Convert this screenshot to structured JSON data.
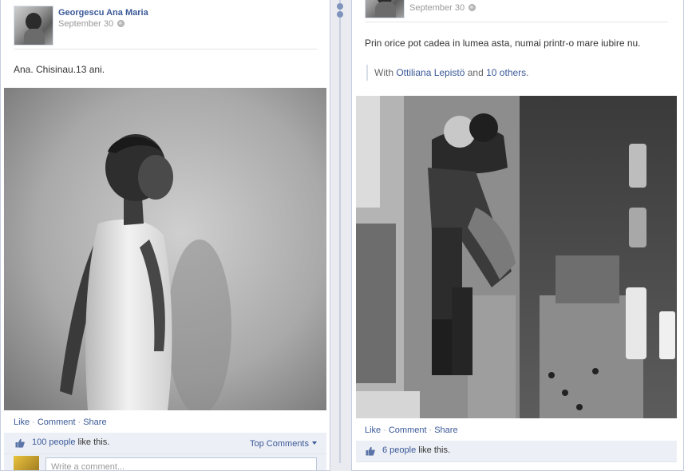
{
  "left_post": {
    "author": "Georgescu Ana Maria",
    "date": "September 30",
    "message": "Ana. Chisinau.13 ani.",
    "actions": {
      "like": "Like",
      "comment": "Comment",
      "share": "Share",
      "sep": "·"
    },
    "likes": {
      "count_link": "100 people",
      "suffix": "like this."
    },
    "top_comments": "Top Comments",
    "comment_placeholder": "Write a comment..."
  },
  "right_post": {
    "date": "September 30",
    "message": "Prin orice pot cadea in lumea asta, numai printr-o mare iubire nu.",
    "with": {
      "prefix": "With",
      "person": "Ottiliana Lepistö",
      "and": "and",
      "others": "10 others",
      "end": "."
    },
    "actions": {
      "like": "Like",
      "comment": "Comment",
      "share": "Share",
      "sep": "·"
    },
    "likes": {
      "count_link": "6 people",
      "suffix": "like this."
    }
  }
}
